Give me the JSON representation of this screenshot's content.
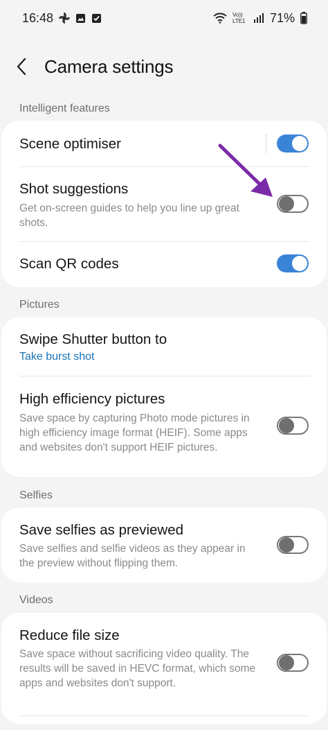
{
  "status_bar": {
    "time": "16:48",
    "network": "Vo)) LTE1",
    "battery": "71%"
  },
  "header": {
    "back_icon": "chevron-left-icon",
    "title": "Camera settings"
  },
  "sections": {
    "intelligent": {
      "label": "Intelligent features",
      "scene_optimiser": {
        "title": "Scene optimiser",
        "enabled": true
      },
      "shot_suggestions": {
        "title": "Shot suggestions",
        "subtitle": "Get on-screen guides to help you line up great shots.",
        "enabled": false
      },
      "scan_qr": {
        "title": "Scan QR codes",
        "enabled": true
      }
    },
    "pictures": {
      "label": "Pictures",
      "swipe_shutter": {
        "title": "Swipe Shutter button to",
        "value": "Take burst shot"
      },
      "high_efficiency": {
        "title": "High efficiency pictures",
        "subtitle": "Save space by capturing Photo mode pictures in high efficiency image format (HEIF). Some apps and websites don't support HEIF pictures.",
        "enabled": false
      }
    },
    "selfies": {
      "label": "Selfies",
      "save_previewed": {
        "title": "Save selfies as previewed",
        "subtitle": "Save selfies and selfie videos as they appear in the preview without flipping them.",
        "enabled": false
      }
    },
    "videos": {
      "label": "Videos",
      "reduce_size": {
        "title": "Reduce file size",
        "subtitle": "Save space without sacrificing video quality. The results will be saved in HEVC format, which some apps and websites don't support.",
        "enabled": false
      }
    }
  },
  "colors": {
    "accent": "#3a84d8",
    "link": "#1a73b8",
    "annotation_arrow": "#7b2aa8"
  }
}
